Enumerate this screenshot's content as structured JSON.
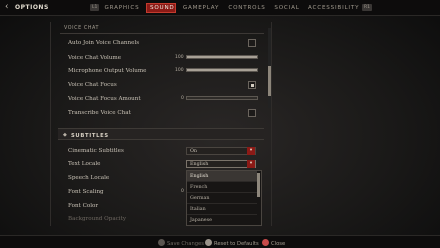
{
  "header": {
    "title": "OPTIONS",
    "left_key": "L1",
    "right_key": "R1",
    "tabs": [
      {
        "label": "GRAPHICS"
      },
      {
        "label": "SOUND",
        "active": true
      },
      {
        "label": "GAMEPLAY"
      },
      {
        "label": "CONTROLS"
      },
      {
        "label": "SOCIAL"
      },
      {
        "label": "ACCESSIBILITY"
      }
    ]
  },
  "voice_chat": {
    "section_title": "VOICE CHAT",
    "auto_join": {
      "label": "Auto Join Voice Channels",
      "checked": false
    },
    "volume": {
      "label": "Voice Chat Volume",
      "value": "100",
      "percent": 100
    },
    "mic_volume": {
      "label": "Microphone Output Volume",
      "value": "100",
      "percent": 100
    },
    "focus": {
      "label": "Voice Chat Focus",
      "checked": true
    },
    "focus_amount": {
      "label": "Voice Chat Focus Amount",
      "value": "0",
      "percent": 0
    },
    "transcribe": {
      "label": "Transcribe Voice Chat",
      "checked": false
    }
  },
  "subtitles": {
    "section_title": "SUBTITLES",
    "cinematic": {
      "label": "Cinematic Subtitles",
      "value": "On"
    },
    "text_locale": {
      "label": "Text Locale",
      "value": "English"
    },
    "speech_locale": {
      "label": "Speech Locale"
    },
    "font_scaling": {
      "label": "Font Scaling",
      "value": "0"
    },
    "font_color": {
      "label": "Font Color"
    },
    "background_opacity": {
      "label": "Background Opacity"
    }
  },
  "locale_dropdown": {
    "options": [
      "English",
      "French",
      "German",
      "Italian",
      "Japanese"
    ],
    "selected": "English"
  },
  "footer": {
    "save": "Save Changes",
    "reset": "Reset to Defaults",
    "close": "Close"
  },
  "colors": {
    "accent": "#8c1a16",
    "save_glyph": "#5a5550",
    "reset_glyph": "#9a938a",
    "close_glyph": "#c84a4a"
  }
}
